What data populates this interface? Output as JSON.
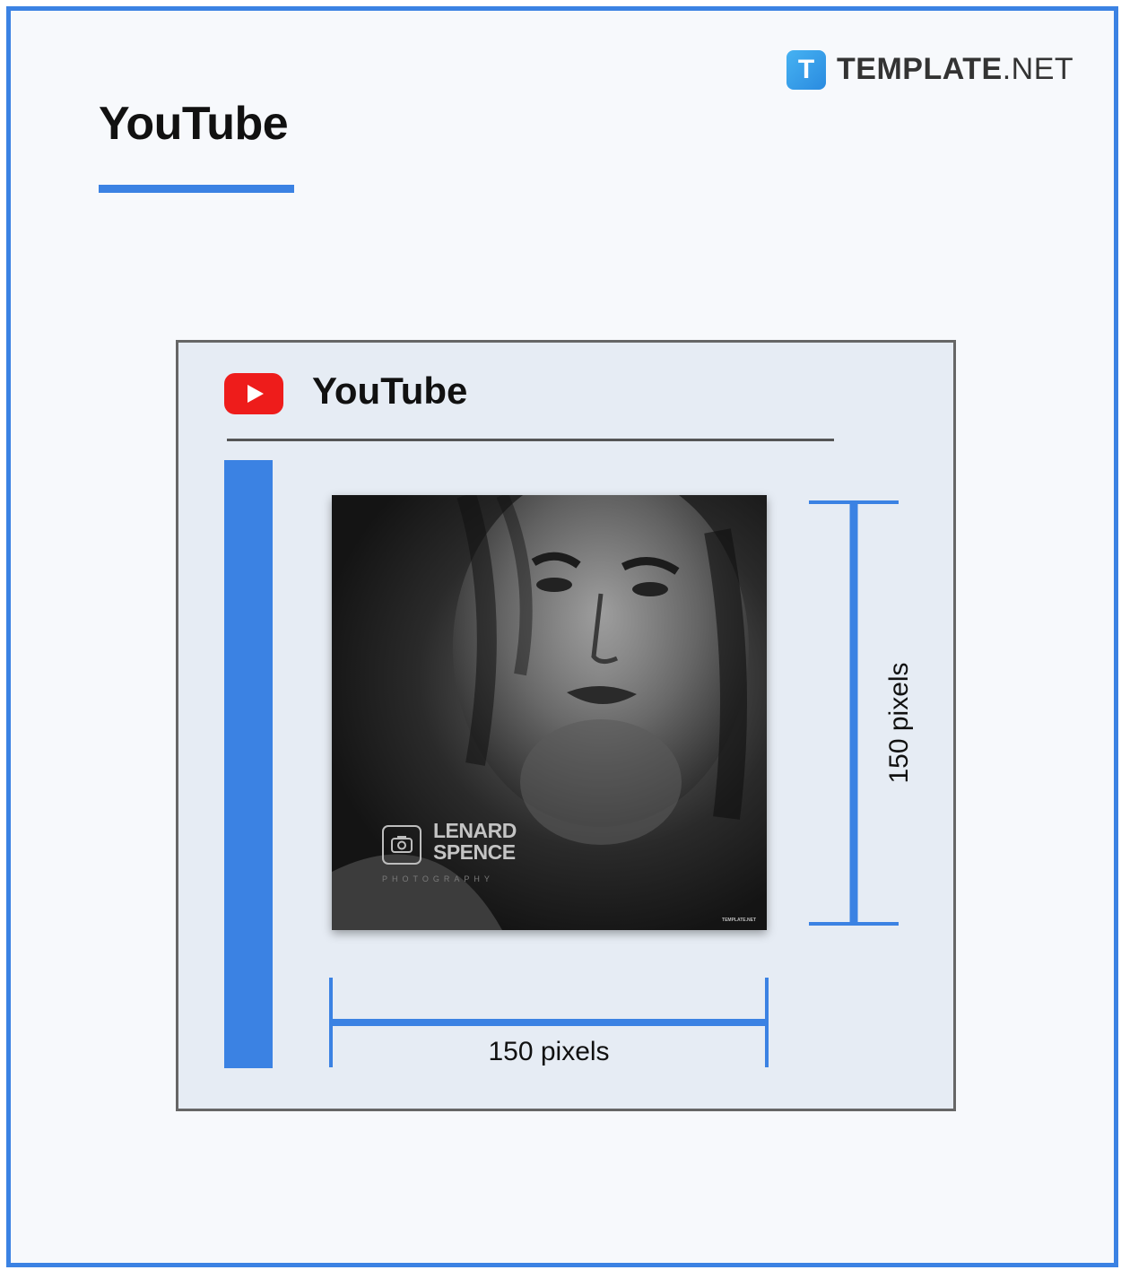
{
  "header": {
    "title": "YouTube",
    "brand": {
      "badge_letter": "T",
      "name_bold": "TEMPLATE",
      "name_light": ".NET"
    }
  },
  "panel": {
    "platform_icon": "youtube-play-icon",
    "platform_name": "YouTube",
    "photo": {
      "icon": "camera-icon",
      "name": "LENARD SPENCE",
      "subtitle": "PHOTOGRAPHY",
      "credit": "TEMPLATE.NET"
    },
    "height_label": "150 pixels",
    "width_label": "150 pixels"
  },
  "colors": {
    "accent": "#3b82e3",
    "youtube_red": "#ee1c1b",
    "panel_bg": "#e6ecf4",
    "page_bg": "#f7f9fc"
  }
}
